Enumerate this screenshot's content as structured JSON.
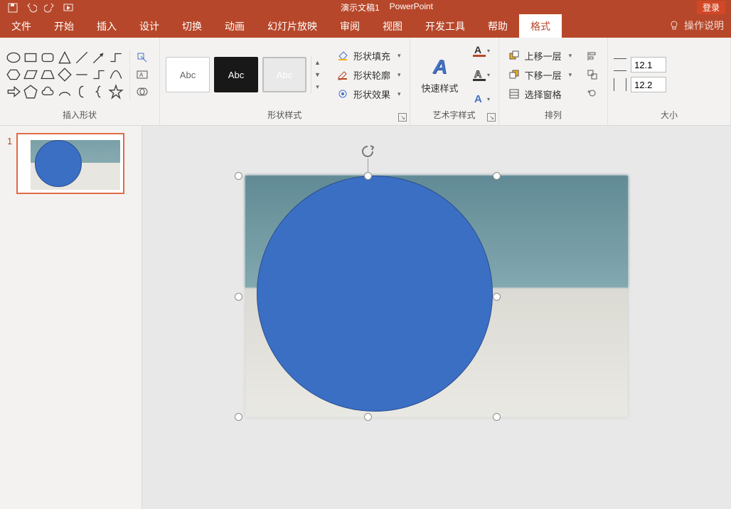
{
  "titlebar": {
    "doc_title": "演示文稿1",
    "app_name": "PowerPoint",
    "login": "登录"
  },
  "tabs": {
    "file": "文件",
    "home": "开始",
    "insert": "插入",
    "design": "设计",
    "transitions": "切换",
    "animations": "动画",
    "slideshow": "幻灯片放映",
    "review": "审阅",
    "view": "视图",
    "developer": "开发工具",
    "help": "帮助",
    "format": "格式",
    "tell_me": "操作说明"
  },
  "groups": {
    "insert_shapes": "插入形状",
    "shape_styles": "形状样式",
    "wordart_styles": "艺术字样式",
    "arrange": "排列",
    "size": "大小"
  },
  "shape_style_sample": "Abc",
  "shape_fill": "形状填充",
  "shape_outline": "形状轮廓",
  "shape_effects": "形状效果",
  "quick_styles": "快速样式",
  "bring_forward": "上移一层",
  "send_backward": "下移一层",
  "selection_pane": "选择窗格",
  "size_height": "12.1",
  "size_width": "12.2",
  "slide_number": "1"
}
